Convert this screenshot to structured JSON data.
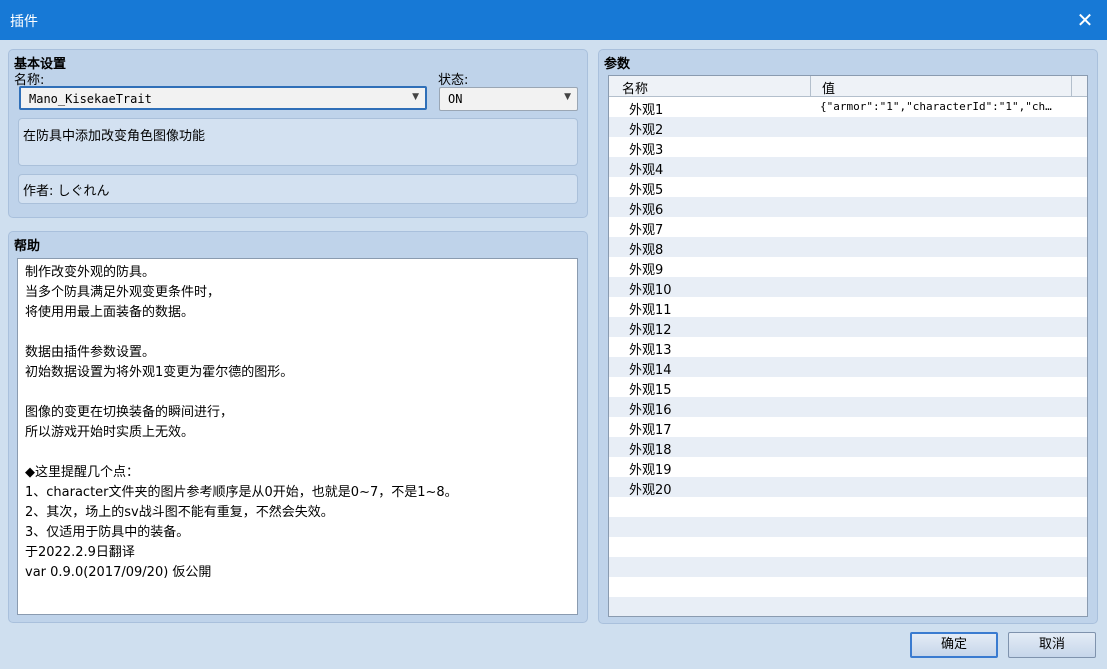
{
  "window": {
    "title": "插件",
    "close_glyph": "✕"
  },
  "basic": {
    "title": "基本设置",
    "name_label": "名称:",
    "name_value": "Mano_KisekaeTrait",
    "status_label": "状态:",
    "status_value": "ON",
    "description": "在防具中添加改变角色图像功能",
    "author": "作者: しぐれん"
  },
  "help": {
    "title": "帮助",
    "lines": [
      "制作改变外观的防具。",
      "当多个防具满足外观变更条件时，",
      "将使用用最上面装备的数据。",
      "",
      "数据由插件参数设置。",
      "初始数据设置为将外观1变更为霍尔德的图形。",
      "",
      "图像的变更在切换装备的瞬间进行，",
      "所以游戏开始时实质上无效。",
      "",
      "◆这里提醒几个点：",
      "1、character文件夹的图片参考顺序是从0开始，也就是0~7，不是1~8。",
      "2、其次，场上的sv战斗图不能有重复，不然会失效。",
      "3、仅适用于防具中的装备。",
      "于2022.2.9日翻译",
      "var 0.9.0(2017/09/20) 仮公開"
    ]
  },
  "params": {
    "title": "参数",
    "col_name": "名称",
    "col_value": "值",
    "rows": [
      {
        "name": "外观1",
        "value": "{\"armor\":\"1\",\"characterId\":\"1\",\"ch…"
      },
      {
        "name": "外观2",
        "value": ""
      },
      {
        "name": "外观3",
        "value": ""
      },
      {
        "name": "外观4",
        "value": ""
      },
      {
        "name": "外观5",
        "value": ""
      },
      {
        "name": "外观6",
        "value": ""
      },
      {
        "name": "外观7",
        "value": ""
      },
      {
        "name": "外观8",
        "value": ""
      },
      {
        "name": "外观9",
        "value": ""
      },
      {
        "name": "外观10",
        "value": ""
      },
      {
        "name": "外观11",
        "value": ""
      },
      {
        "name": "外观12",
        "value": ""
      },
      {
        "name": "外观13",
        "value": ""
      },
      {
        "name": "外观14",
        "value": ""
      },
      {
        "name": "外观15",
        "value": ""
      },
      {
        "name": "外观16",
        "value": ""
      },
      {
        "name": "外观17",
        "value": ""
      },
      {
        "name": "外观18",
        "value": ""
      },
      {
        "name": "外观19",
        "value": ""
      },
      {
        "name": "外观20",
        "value": ""
      }
    ]
  },
  "buttons": {
    "ok": "确定",
    "cancel": "取消"
  }
}
